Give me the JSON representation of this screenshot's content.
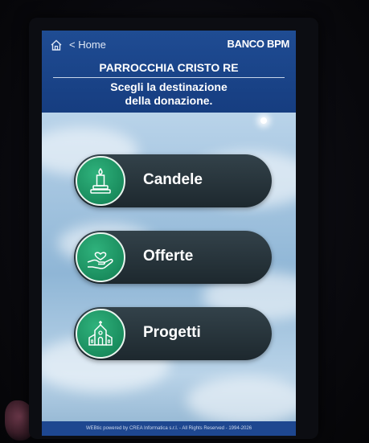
{
  "topbar": {
    "home_label": "< Home",
    "home_icon": "home-icon",
    "brand": "BANCO BPM"
  },
  "header": {
    "parish": "PARROCCHIA CRISTO RE",
    "instruction_line1": "Scegli la destinazione",
    "instruction_line2": "della donazione."
  },
  "choices": [
    {
      "label": "Candele",
      "icon": "candle-icon"
    },
    {
      "label": "Offerte",
      "icon": "hand-heart-icon"
    },
    {
      "label": "Progetti",
      "icon": "church-icon"
    }
  ],
  "footer": {
    "text": "WEBtic powered by CREA Informatica s.r.l. - All Rights Reserved - 1994-2026"
  },
  "colors": {
    "header_blue": "#1f4c93",
    "button_dark": "#2a373e",
    "icon_green": "#1a8d5e"
  }
}
